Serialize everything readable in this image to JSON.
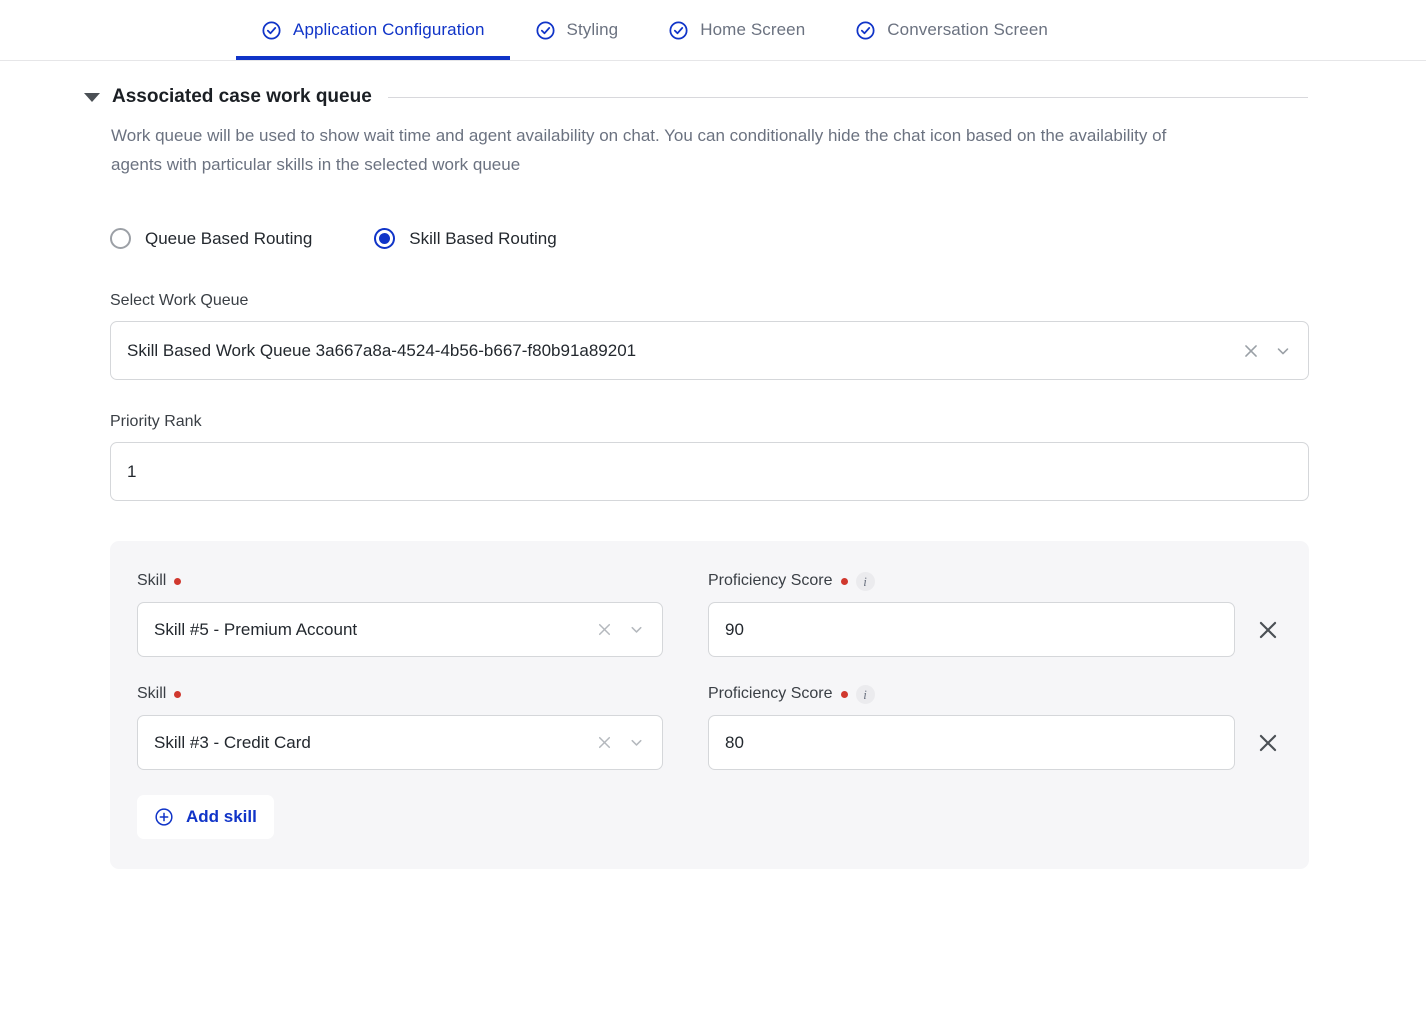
{
  "tabs": [
    {
      "label": "Application Configuration",
      "icon": "circle-check-icon",
      "active": true
    },
    {
      "label": "Styling",
      "icon": "circle-check-icon",
      "active": false
    },
    {
      "label": "Home Screen",
      "icon": "circle-check-icon",
      "active": false
    },
    {
      "label": "Conversation Screen",
      "icon": "circle-check-icon",
      "active": false
    }
  ],
  "section": {
    "title": "Associated case work queue",
    "description": "Work queue will be used to show wait time and agent availability on chat. You can conditionally hide the chat icon based on the availability of agents with particular skills in the selected work queue",
    "caret_icon": "caret-down-icon"
  },
  "routing": {
    "options": [
      {
        "label": "Queue Based Routing",
        "selected": false
      },
      {
        "label": "Skill Based Routing",
        "selected": true
      }
    ]
  },
  "work_queue": {
    "label": "Select Work Queue",
    "value": "Skill Based Work Queue 3a667a8a-4524-4b56-b667-f80b91a89201",
    "clear_icon": "close-icon",
    "dropdown_icon": "chevron-down-icon"
  },
  "priority_rank": {
    "label": "Priority Rank",
    "value": "1"
  },
  "skills_panel": {
    "skill_label": "Skill",
    "score_label": "Proficiency Score",
    "required_marker": "required-dot",
    "info_icon": "info-icon",
    "clear_icon": "close-icon",
    "dropdown_icon": "chevron-down-icon",
    "delete_icon": "close-icon",
    "rows": [
      {
        "skill": "Skill #5 - Premium Account",
        "score": "90"
      },
      {
        "skill": "Skill #3 - Credit Card",
        "score": "80"
      }
    ],
    "add_button": {
      "label": "Add skill",
      "icon": "plus-circle-icon"
    }
  },
  "colors": {
    "accent": "#1034c8",
    "required": "#d0382e",
    "panel_bg": "#f6f6f8",
    "muted_text": "#6b7280",
    "border": "#d5d7da"
  }
}
